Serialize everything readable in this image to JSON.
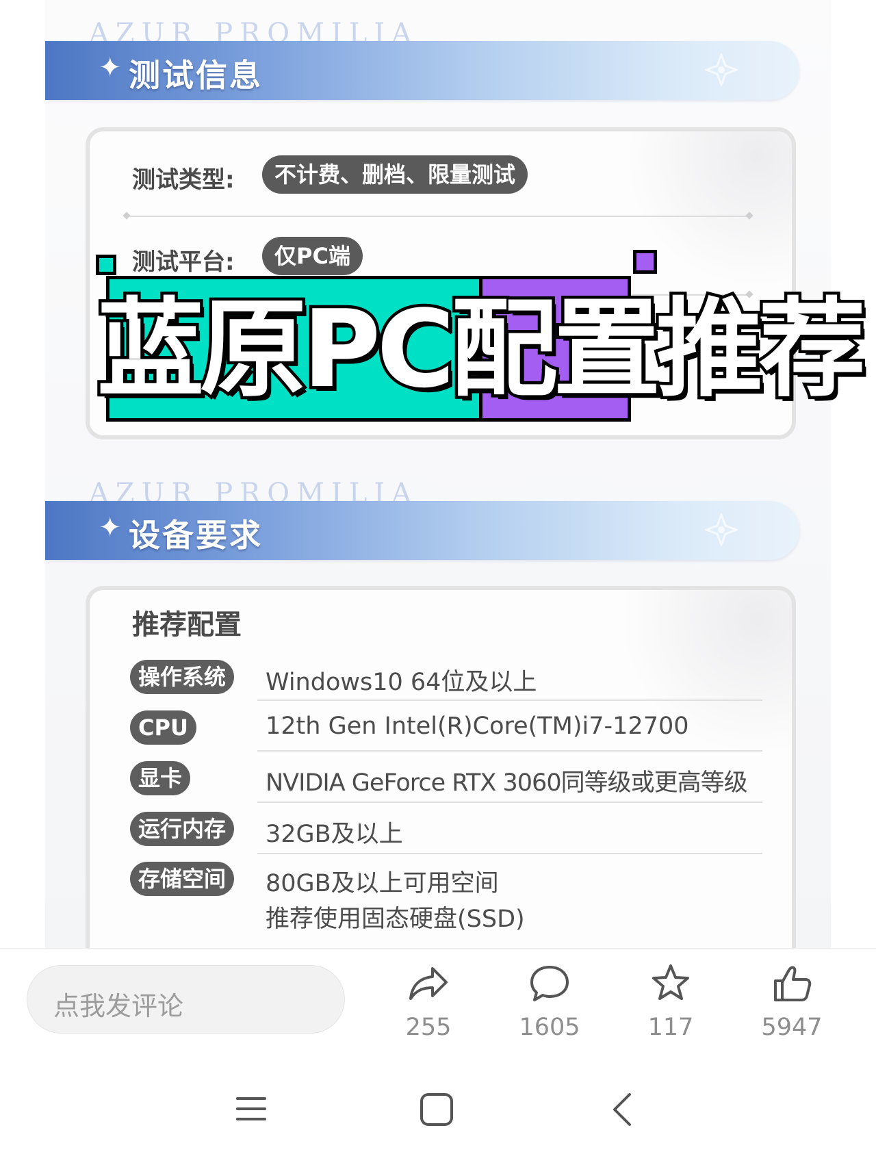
{
  "post": {
    "brand_text": "AZUR PROMILIA",
    "sections": {
      "info_title": "测试信息",
      "requirements_title": "设备要求"
    },
    "info": {
      "type_label": "测试类型:",
      "type_value": "不计费、删档、限量测试",
      "platform_label": "测试平台:",
      "platform_value": "仅PC端"
    },
    "overlay_title": "蓝原PC配置推荐",
    "requirements": {
      "heading": "推荐配置",
      "rows": [
        {
          "label": "操作系统",
          "value": "Windows10 64位及以上"
        },
        {
          "label": "CPU",
          "value": "12th Gen Intel(R)Core(TM)i7-12700"
        },
        {
          "label": "显卡",
          "value": "NVIDIA GeForce RTX 3060同等级或更高等级"
        },
        {
          "label": "运行内存",
          "value": "32GB及以上"
        },
        {
          "label": "存储空间",
          "value": "80GB及以上可用空间",
          "value2": "推荐使用固态硬盘(SSD)"
        }
      ]
    }
  },
  "action_bar": {
    "comment_placeholder": "点我发评论",
    "share_count": "255",
    "comment_count": "1605",
    "favorite_count": "117",
    "like_count": "5947"
  },
  "colors": {
    "overlay_teal": "#00e0c4",
    "overlay_purple": "#a45ff2",
    "banner_blue": "#4d77c4"
  }
}
